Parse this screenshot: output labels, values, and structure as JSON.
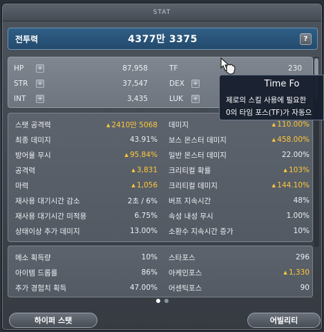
{
  "window": {
    "title": "STAT"
  },
  "combat_power": {
    "label": "전투력",
    "value": "4377만 3375",
    "help_label": "?"
  },
  "basic_stats": [
    {
      "label": "HP",
      "value": "87,958",
      "has_plus": true
    },
    {
      "label": "TF",
      "value": "230",
      "has_plus": false
    },
    {
      "label": "STR",
      "value": "37,547",
      "has_plus": true
    },
    {
      "label": "DEX",
      "value": "",
      "has_plus": true
    },
    {
      "label": "INT",
      "value": "3,435",
      "has_plus": true
    },
    {
      "label": "LUK",
      "value": "",
      "has_plus": true
    }
  ],
  "detail_stats": [
    {
      "label": "스탯 공격력",
      "value": "2410만 5068",
      "up": true
    },
    {
      "label": "데미지",
      "value": "110.00%",
      "up": true
    },
    {
      "label": "최종 데미지",
      "value": "43.91%",
      "up": false
    },
    {
      "label": "보스 몬스터 데미지",
      "value": "458.00%",
      "up": true
    },
    {
      "label": "방어율 무시",
      "value": "95.84%",
      "up": true
    },
    {
      "label": "일반 몬스터 데미지",
      "value": "22.00%",
      "up": false
    },
    {
      "label": "공격력",
      "value": "3,831",
      "up": true
    },
    {
      "label": "크리티컬 확률",
      "value": "103%",
      "up": true
    },
    {
      "label": "마력",
      "value": "1,056",
      "up": true
    },
    {
      "label": "크리티컬 데미지",
      "value": "144.10%",
      "up": true
    },
    {
      "label": "재사용 대기시간 감소",
      "value": "2초 / 6%",
      "up": false
    },
    {
      "label": "버프 지속시간",
      "value": "48%",
      "up": false
    },
    {
      "label": "재사용 대기시간 미적용",
      "value": "6.75%",
      "up": false
    },
    {
      "label": "속성 내성 무시",
      "value": "1.00%",
      "up": false
    },
    {
      "label": "상태이상 추가 데미지",
      "value": "13.00%",
      "up": false
    },
    {
      "label": "소환수 지속시간 증가",
      "value": "10%",
      "up": false
    }
  ],
  "extra_stats": [
    {
      "label": "메소 획득량",
      "value": "10%",
      "up": false
    },
    {
      "label": "스타포스",
      "value": "296",
      "up": false
    },
    {
      "label": "아이템 드롭률",
      "value": "86%",
      "up": false
    },
    {
      "label": "아케인포스",
      "value": "1,330",
      "up": true
    },
    {
      "label": "추가 경험치 획득",
      "value": "47.00%",
      "up": false
    },
    {
      "label": "어센틱포스",
      "value": "90",
      "up": false
    }
  ],
  "pagination": {
    "total": 2,
    "active": 1
  },
  "buttons": {
    "hyper_stat": "하이퍼 스탯",
    "ability": "어빌리티"
  },
  "tooltip": {
    "title": "Time Fo",
    "line1": "제로의 스킬 사용에 필요한",
    "line2": "0의 타임 포스(TF)가 자동으"
  },
  "colors": {
    "accent_up": "#ffc83a",
    "power_bar": "#2f5e86",
    "panel": "#7f868f"
  },
  "icons": {
    "plus": "plus-icon",
    "help": "question-icon",
    "cursor": "hand-cursor-icon",
    "up": "up-arrow-icon"
  }
}
